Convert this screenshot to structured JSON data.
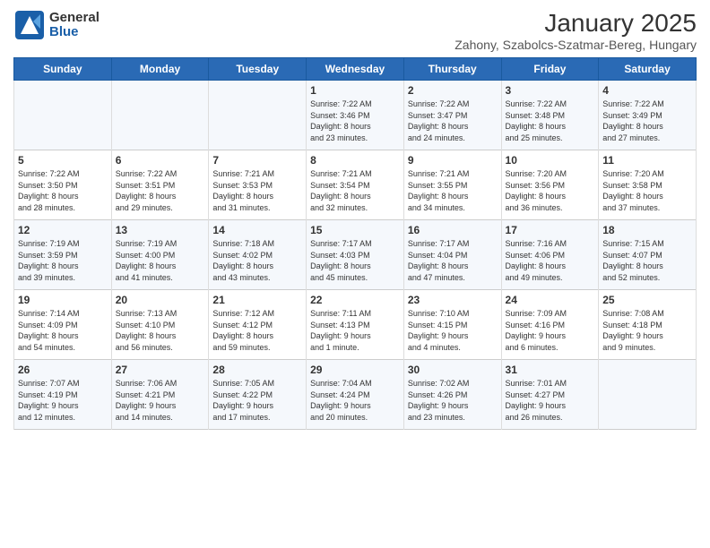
{
  "logo": {
    "general": "General",
    "blue": "Blue"
  },
  "title": "January 2025",
  "subtitle": "Zahony, Szabolcs-Szatmar-Bereg, Hungary",
  "weekdays": [
    "Sunday",
    "Monday",
    "Tuesday",
    "Wednesday",
    "Thursday",
    "Friday",
    "Saturday"
  ],
  "weeks": [
    [
      {
        "day": "",
        "info": ""
      },
      {
        "day": "",
        "info": ""
      },
      {
        "day": "",
        "info": ""
      },
      {
        "day": "1",
        "info": "Sunrise: 7:22 AM\nSunset: 3:46 PM\nDaylight: 8 hours\nand 23 minutes."
      },
      {
        "day": "2",
        "info": "Sunrise: 7:22 AM\nSunset: 3:47 PM\nDaylight: 8 hours\nand 24 minutes."
      },
      {
        "day": "3",
        "info": "Sunrise: 7:22 AM\nSunset: 3:48 PM\nDaylight: 8 hours\nand 25 minutes."
      },
      {
        "day": "4",
        "info": "Sunrise: 7:22 AM\nSunset: 3:49 PM\nDaylight: 8 hours\nand 27 minutes."
      }
    ],
    [
      {
        "day": "5",
        "info": "Sunrise: 7:22 AM\nSunset: 3:50 PM\nDaylight: 8 hours\nand 28 minutes."
      },
      {
        "day": "6",
        "info": "Sunrise: 7:22 AM\nSunset: 3:51 PM\nDaylight: 8 hours\nand 29 minutes."
      },
      {
        "day": "7",
        "info": "Sunrise: 7:21 AM\nSunset: 3:53 PM\nDaylight: 8 hours\nand 31 minutes."
      },
      {
        "day": "8",
        "info": "Sunrise: 7:21 AM\nSunset: 3:54 PM\nDaylight: 8 hours\nand 32 minutes."
      },
      {
        "day": "9",
        "info": "Sunrise: 7:21 AM\nSunset: 3:55 PM\nDaylight: 8 hours\nand 34 minutes."
      },
      {
        "day": "10",
        "info": "Sunrise: 7:20 AM\nSunset: 3:56 PM\nDaylight: 8 hours\nand 36 minutes."
      },
      {
        "day": "11",
        "info": "Sunrise: 7:20 AM\nSunset: 3:58 PM\nDaylight: 8 hours\nand 37 minutes."
      }
    ],
    [
      {
        "day": "12",
        "info": "Sunrise: 7:19 AM\nSunset: 3:59 PM\nDaylight: 8 hours\nand 39 minutes."
      },
      {
        "day": "13",
        "info": "Sunrise: 7:19 AM\nSunset: 4:00 PM\nDaylight: 8 hours\nand 41 minutes."
      },
      {
        "day": "14",
        "info": "Sunrise: 7:18 AM\nSunset: 4:02 PM\nDaylight: 8 hours\nand 43 minutes."
      },
      {
        "day": "15",
        "info": "Sunrise: 7:17 AM\nSunset: 4:03 PM\nDaylight: 8 hours\nand 45 minutes."
      },
      {
        "day": "16",
        "info": "Sunrise: 7:17 AM\nSunset: 4:04 PM\nDaylight: 8 hours\nand 47 minutes."
      },
      {
        "day": "17",
        "info": "Sunrise: 7:16 AM\nSunset: 4:06 PM\nDaylight: 8 hours\nand 49 minutes."
      },
      {
        "day": "18",
        "info": "Sunrise: 7:15 AM\nSunset: 4:07 PM\nDaylight: 8 hours\nand 52 minutes."
      }
    ],
    [
      {
        "day": "19",
        "info": "Sunrise: 7:14 AM\nSunset: 4:09 PM\nDaylight: 8 hours\nand 54 minutes."
      },
      {
        "day": "20",
        "info": "Sunrise: 7:13 AM\nSunset: 4:10 PM\nDaylight: 8 hours\nand 56 minutes."
      },
      {
        "day": "21",
        "info": "Sunrise: 7:12 AM\nSunset: 4:12 PM\nDaylight: 8 hours\nand 59 minutes."
      },
      {
        "day": "22",
        "info": "Sunrise: 7:11 AM\nSunset: 4:13 PM\nDaylight: 9 hours\nand 1 minute."
      },
      {
        "day": "23",
        "info": "Sunrise: 7:10 AM\nSunset: 4:15 PM\nDaylight: 9 hours\nand 4 minutes."
      },
      {
        "day": "24",
        "info": "Sunrise: 7:09 AM\nSunset: 4:16 PM\nDaylight: 9 hours\nand 6 minutes."
      },
      {
        "day": "25",
        "info": "Sunrise: 7:08 AM\nSunset: 4:18 PM\nDaylight: 9 hours\nand 9 minutes."
      }
    ],
    [
      {
        "day": "26",
        "info": "Sunrise: 7:07 AM\nSunset: 4:19 PM\nDaylight: 9 hours\nand 12 minutes."
      },
      {
        "day": "27",
        "info": "Sunrise: 7:06 AM\nSunset: 4:21 PM\nDaylight: 9 hours\nand 14 minutes."
      },
      {
        "day": "28",
        "info": "Sunrise: 7:05 AM\nSunset: 4:22 PM\nDaylight: 9 hours\nand 17 minutes."
      },
      {
        "day": "29",
        "info": "Sunrise: 7:04 AM\nSunset: 4:24 PM\nDaylight: 9 hours\nand 20 minutes."
      },
      {
        "day": "30",
        "info": "Sunrise: 7:02 AM\nSunset: 4:26 PM\nDaylight: 9 hours\nand 23 minutes."
      },
      {
        "day": "31",
        "info": "Sunrise: 7:01 AM\nSunset: 4:27 PM\nDaylight: 9 hours\nand 26 minutes."
      },
      {
        "day": "",
        "info": ""
      }
    ]
  ]
}
